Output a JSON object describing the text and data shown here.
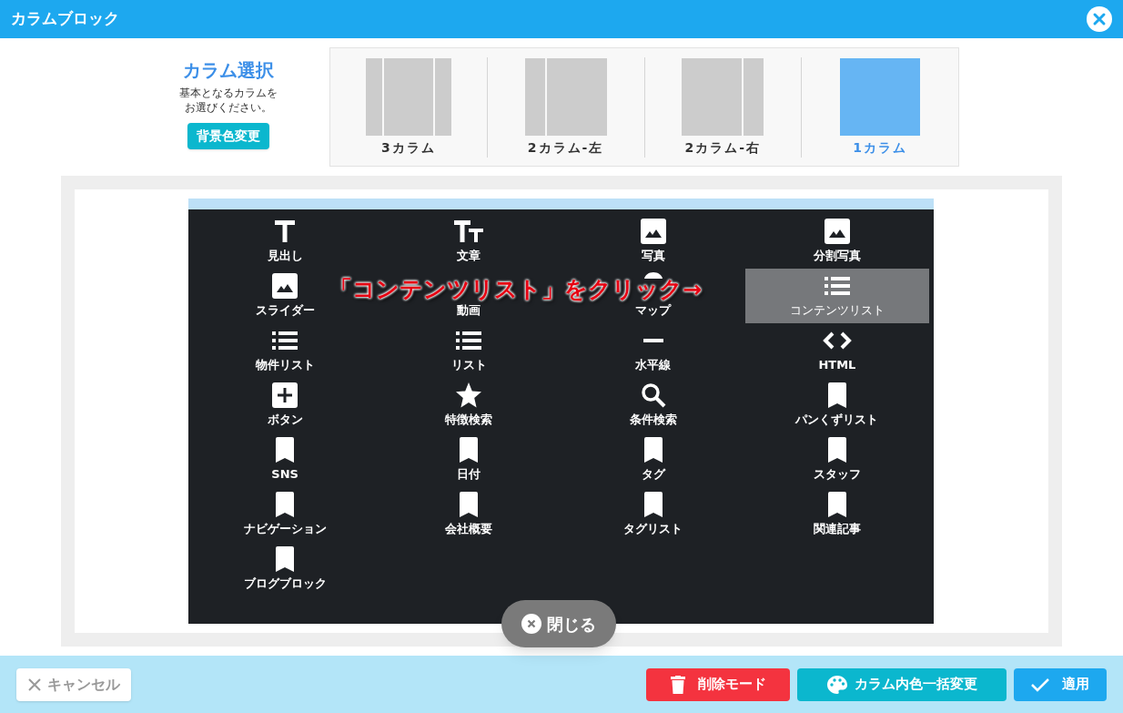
{
  "window": {
    "title": "カラムブロック"
  },
  "column_select": {
    "title": "カラム選択",
    "description": "基本となるカラムをお選びください。",
    "button": "背景色変更"
  },
  "column_options": [
    {
      "kind": "three",
      "label": "3カラム",
      "selected": false
    },
    {
      "kind": "left",
      "label": "2カラム-左",
      "selected": false
    },
    {
      "kind": "right",
      "label": "2カラム-右",
      "selected": false
    },
    {
      "kind": "one",
      "label": "1カラム",
      "selected": true
    }
  ],
  "blocks": [
    {
      "kind": "heading",
      "label": "見出し",
      "selected": false
    },
    {
      "kind": "text",
      "label": "文章",
      "selected": false
    },
    {
      "kind": "image",
      "label": "写真",
      "selected": false
    },
    {
      "kind": "image",
      "label": "分割写真",
      "selected": false
    },
    {
      "kind": "image",
      "label": "スライダー",
      "selected": false
    },
    {
      "kind": "covered",
      "label": "動画",
      "selected": false
    },
    {
      "kind": "pin_top",
      "label": "マップ",
      "selected": false
    },
    {
      "kind": "list",
      "label": "コンテンツリスト",
      "selected": true
    },
    {
      "kind": "list",
      "label": "物件リスト",
      "selected": false
    },
    {
      "kind": "list",
      "label": "リスト",
      "selected": false
    },
    {
      "kind": "rule",
      "label": "水平線",
      "selected": false
    },
    {
      "kind": "code",
      "label": "HTML",
      "selected": false
    },
    {
      "kind": "plus",
      "label": "ボタン",
      "selected": false
    },
    {
      "kind": "star",
      "label": "特徴検索",
      "selected": false
    },
    {
      "kind": "search",
      "label": "条件検索",
      "selected": false
    },
    {
      "kind": "bookmark",
      "label": "パンくずリスト",
      "selected": false
    },
    {
      "kind": "bookmark",
      "label": "SNS",
      "selected": false
    },
    {
      "kind": "bookmark",
      "label": "日付",
      "selected": false
    },
    {
      "kind": "bookmark",
      "label": "タグ",
      "selected": false
    },
    {
      "kind": "bookmark",
      "label": "スタッフ",
      "selected": false
    },
    {
      "kind": "bookmark",
      "label": "ナビゲーション",
      "selected": false
    },
    {
      "kind": "bookmark",
      "label": "会社概要",
      "selected": false
    },
    {
      "kind": "bookmark",
      "label": "タグリスト",
      "selected": false
    },
    {
      "kind": "bookmark",
      "label": "関連記事",
      "selected": false
    },
    {
      "kind": "bookmark",
      "label": "ブログブロック",
      "selected": false
    }
  ],
  "annotation": "「コンテンツリスト」をクリック→",
  "close_button": "閉じる",
  "footer": {
    "cancel": "キャンセル",
    "delete_mode": "削除モード",
    "bulk_color": "カラム内色一括変更",
    "apply": "適用"
  }
}
